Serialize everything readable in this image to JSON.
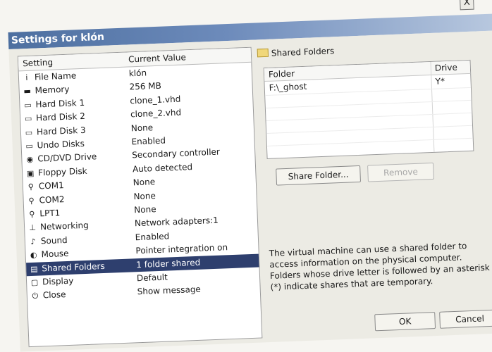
{
  "dialog": {
    "title": "Settings for klón",
    "close_glyph": "X"
  },
  "settings": {
    "col_setting": "Setting",
    "col_value": "Current Value",
    "rows": [
      {
        "icon": "info-icon",
        "label": "File Name",
        "value": "klón"
      },
      {
        "icon": "memory-icon",
        "label": "Memory",
        "value": "256 MB"
      },
      {
        "icon": "hard-disk-icon",
        "label": "Hard Disk 1",
        "value": "clone_1.vhd"
      },
      {
        "icon": "hard-disk-icon",
        "label": "Hard Disk 2",
        "value": "clone_2.vhd"
      },
      {
        "icon": "hard-disk-icon",
        "label": "Hard Disk 3",
        "value": "None"
      },
      {
        "icon": "undo-disk-icon",
        "label": "Undo Disks",
        "value": "Enabled"
      },
      {
        "icon": "cd-dvd-icon",
        "label": "CD/DVD Drive",
        "value": "Secondary controller"
      },
      {
        "icon": "floppy-disk-icon",
        "label": "Floppy Disk",
        "value": "Auto detected"
      },
      {
        "icon": "serial-port-icon",
        "label": "COM1",
        "value": "None"
      },
      {
        "icon": "serial-port-icon",
        "label": "COM2",
        "value": "None"
      },
      {
        "icon": "parallel-port-icon",
        "label": "LPT1",
        "value": "None"
      },
      {
        "icon": "network-icon",
        "label": "Networking",
        "value": "Network adapters:1"
      },
      {
        "icon": "sound-icon",
        "label": "Sound",
        "value": "Enabled"
      },
      {
        "icon": "mouse-icon",
        "label": "Mouse",
        "value": "Pointer integration on"
      },
      {
        "icon": "shared-folder-icon",
        "label": "Shared Folders",
        "value": "1 folder shared",
        "selected": true
      },
      {
        "icon": "display-icon",
        "label": "Display",
        "value": "Default"
      },
      {
        "icon": "close-icon",
        "label": "Close",
        "value": "Show message"
      }
    ]
  },
  "shared": {
    "title": "Shared Folders",
    "col_folder": "Folder",
    "col_drive": "Drive",
    "folders": [
      {
        "folder": "F:\\_ghost",
        "drive": "Y*"
      }
    ],
    "share_button": "Share Folder...",
    "remove_button": "Remove",
    "description": "The virtual machine can use a shared folder to access information on the physical computer. Folders whose drive letter is followed by an asterisk (*) indicate shares that are temporary."
  },
  "footer": {
    "ok": "OK",
    "cancel": "Cancel"
  },
  "colors": {
    "selection": "#2e3f6e",
    "titlebar": "#4d6fa0"
  }
}
